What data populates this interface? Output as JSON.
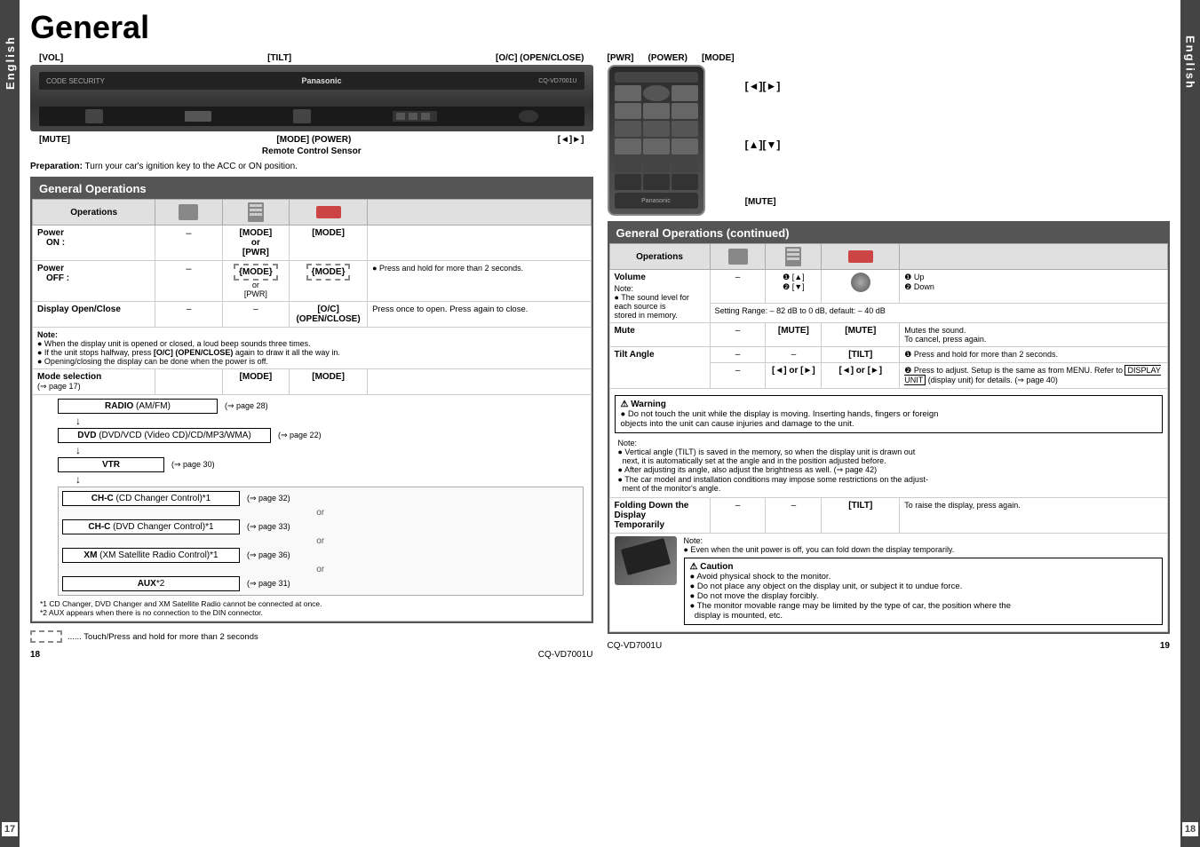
{
  "title": "General",
  "pageNumbers": {
    "leftPage": "17",
    "rightPage": "18",
    "leftPageBottom": "18",
    "rightPageBottom": "19",
    "model": "CQ-VD7001U"
  },
  "sideLabel": "English",
  "preparation": {
    "label": "Preparation:",
    "text": "Turn your car's ignition key to the ACC or ON position."
  },
  "leftDiagram": {
    "labels": {
      "vol": "[VOL]",
      "tilt": "[TILT]",
      "openClose": "[O/C] (OPEN/CLOSE)",
      "mute": "[MUTE]",
      "modePower": "[MODE] (POWER)",
      "arrows": "[◄]►]",
      "remoteLabel": "Remote Control Sensor"
    }
  },
  "rightDiagram": {
    "labels": {
      "pwr": "[PWR]",
      "power": "(POWER)",
      "mode": "[MODE]",
      "arrows1": "[◄][►]",
      "arrowsUpDown": "[▲][▼]",
      "mute": "[MUTE]"
    }
  },
  "leftTable": {
    "title": "General Operations",
    "colHeaders": [
      "Operations",
      "",
      "",
      ""
    ],
    "rows": [
      {
        "id": "power-on",
        "label": "Power",
        "sublabel": "ON :",
        "col1": "–",
        "col2": "[MODE]\nor\n[PWR]",
        "col3": "[MODE]",
        "col4": ""
      },
      {
        "id": "power-off",
        "label": "Power",
        "sublabel": "OFF :",
        "col1": "–",
        "col2": "{MODE}\nor\n[PWR]",
        "col3": "{MODE}",
        "col4": "● Press and hold for more than 2 seconds."
      },
      {
        "id": "display-open-close",
        "label": "Display Open/Close",
        "sublabel": "",
        "col1": "–",
        "col2": "–",
        "col3": "[O/C]\n(OPEN/CLOSE)",
        "col4": "Press once to open. Press again to close.",
        "note": "Note:\n● When the display unit is opened or closed, a loud beep sounds three times.\n● If the unit stops halfway, press [O/C] (OPEN/CLOSE) again to draw it all the way in.\n● Opening/closing the display can be done when the power is off."
      },
      {
        "id": "mode-selection",
        "label": "Mode selection",
        "sublabel": "(⇒ page 17)",
        "col1": "",
        "col2": "[MODE]",
        "col3": "[MODE]",
        "col4": ""
      }
    ],
    "modeFlow": [
      {
        "label": "RADIO (AM/FM)",
        "ref": "(⇒ page 28)"
      },
      {
        "label": "DVD (DVD/VCD (Video CD)/CD/MP3/WMA)",
        "ref": "(⇒ page 22)"
      },
      {
        "label": "VTR",
        "ref": "(⇒ page 30)"
      },
      {
        "label": "CH-C (CD Changer Control)*1",
        "ref": "(⇒ page 32)"
      },
      {
        "label": "CH-C (DVD Changer Control)*1",
        "ref": "(⇒ page 33)"
      },
      {
        "label": "XM (XM Satellite Radio Control)*1",
        "ref": "(⇒ page 36)"
      },
      {
        "label": "AUX*2",
        "ref": "(⇒ page 31)"
      }
    ],
    "footnotes": [
      "*1 CD Changer, DVD Changer and XM Satellite Radio cannot be connected at once.",
      "*2 AUX appears when there is no connection to the DIN connector."
    ],
    "touchNote": "...... Touch/Press and hold for more than 2 seconds"
  },
  "rightTable": {
    "title": "General Operations (continued)",
    "rows": [
      {
        "id": "volume",
        "label": "Volume",
        "noteLines": [
          "Note:",
          "● The sound level for",
          "each source is",
          "stored in memory."
        ],
        "col1": "–",
        "col2": "❶ [▲]\n❷ [▼]",
        "col3": "(knob)",
        "col4": "❶ Up\n❷ Down",
        "extra": "Setting Range: – 82 dB to 0 dB,  default: – 40 dB"
      },
      {
        "id": "mute",
        "label": "Mute",
        "col1": "–",
        "col2": "[MUTE]",
        "col3": "[MUTE]",
        "col4": "Mutes the sound.\nTo cancel, press again."
      },
      {
        "id": "tilt-angle",
        "label": "Tilt Angle",
        "col1": "–",
        "col2": "–",
        "col3": "[TILT]",
        "col4": "❶ Press and hold for more than 2 seconds.",
        "row2": {
          "col1": "–",
          "col2": "[◄] or [►]",
          "col3": "[◄] or [►]",
          "col4": "❷ Press to adjust. Setup is the same as from MENU. Refer to DISPLAY UNIT (display unit) for details. (⇒ page 40)"
        },
        "warning": {
          "title": "⚠ Warning",
          "lines": [
            "● Do not touch the unit while the display is moving. Inserting hands, fingers or foreign",
            "objects into the unit can cause injuries and damage to the unit."
          ]
        },
        "note": {
          "lines": [
            "Note:",
            "● Vertical angle (TILT) is saved in the memory, so when the display unit is drawn out",
            "  next, it is automatically set at the angle and in the position adjusted before.",
            "● After adjusting its angle, also adjust the brightness as well. (⇒ page 42)",
            "● The car model and installation conditions may impose some restrictions on the adjust-",
            "  ment of the monitor's angle."
          ]
        }
      },
      {
        "id": "folding",
        "label": "Folding Down the\nDisplay\nTemporarily",
        "col1": "–",
        "col2": "–",
        "col3": "[TILT]",
        "col4": "To raise the display, press again.",
        "note": {
          "lines": [
            "Note:",
            "● Even when the unit power is off, you can fold down the display temporarily."
          ]
        },
        "caution": {
          "title": "⚠ Caution",
          "lines": [
            "● Avoid physical shock to the monitor.",
            "● Do not place any object on the display unit, or subject it to undue force.",
            "● Do not move the display forcibly.",
            "● The monitor movable range may be limited by the type of car, the position where the",
            "  display is mounted, etc."
          ]
        }
      }
    ]
  }
}
